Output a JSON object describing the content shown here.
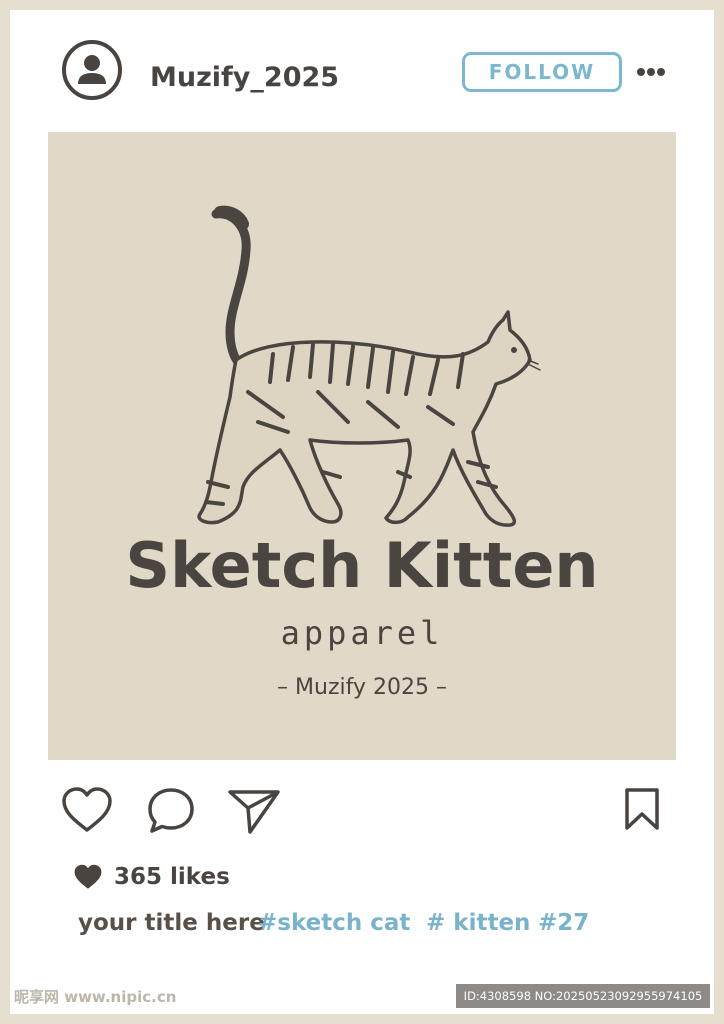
{
  "header": {
    "username": "Muzify_2025",
    "follow_label": "FOLLOW",
    "avatar_icon": "user-icon",
    "more_icon": "more-dots-icon"
  },
  "artwork": {
    "title": "Sketch Kitten",
    "subtitle": "apparel",
    "tagline": "– Muzify 2025 –"
  },
  "actions": {
    "icons": [
      "heart-icon",
      "comment-icon",
      "share-icon",
      "bookmark-icon"
    ]
  },
  "stats": {
    "likes_icon": "heart-filled-icon",
    "likes_text": "365 likes"
  },
  "caption": {
    "title": "your title here",
    "tags": [
      "#sketch cat",
      "# kitten",
      "#27"
    ]
  },
  "watermark": {
    "site": "昵享网 www.nipic.cn",
    "id_text": "ID:4308598 NO:20250523092955974105"
  },
  "colors": {
    "background": "#e6dfd0",
    "card": "#ffffff",
    "image_bg": "#e1d9c8",
    "text_dark": "#4a4440",
    "accent_blue": "#7bb7cf"
  }
}
